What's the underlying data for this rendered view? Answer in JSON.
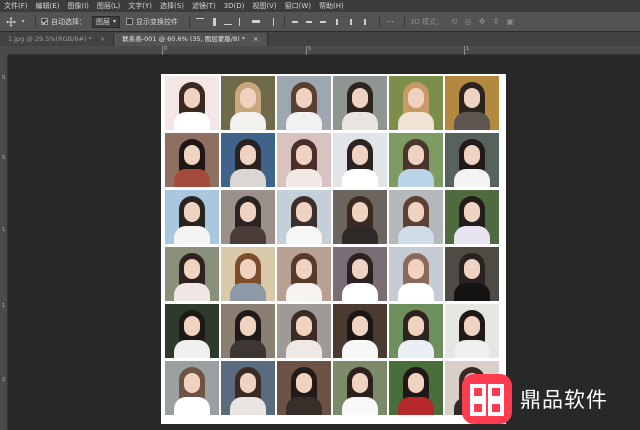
{
  "menu": [
    "文件(F)",
    "编辑(E)",
    "图像(I)",
    "图层(L)",
    "文字(Y)",
    "选择(S)",
    "滤镜(T)",
    "3D(D)",
    "视图(V)",
    "窗口(W)",
    "帮助(H)"
  ],
  "options": {
    "auto_select_label": "自动选择：",
    "auto_select_value": "图层",
    "show_transform_label": "显示变换控件",
    "mode_3d_label": "3D 模式："
  },
  "tabs": [
    {
      "label": "1.jpg @ 29.5%(RGB/8#) *",
      "close": "×"
    },
    {
      "label": "联系表-001 @ 60.6% (35, 图层蒙版/8) *",
      "close": "×"
    }
  ],
  "ruler": {
    "top": [
      "0",
      "5",
      "1"
    ],
    "left": [
      "0",
      "5",
      "1",
      "1",
      "2"
    ]
  },
  "photos": [
    {
      "bg": "#f2e7e4",
      "hair": "#3b2a22",
      "body": "#ffffff"
    },
    {
      "bg": "#6f6a4a",
      "hair": "#c9a77d",
      "body": "#f3f1ee"
    },
    {
      "bg": "#9ea7b0",
      "hair": "#5a4032",
      "body": "#f1f1f1"
    },
    {
      "bg": "#8f9692",
      "hair": "#2d231f",
      "body": "#e7e4e1"
    },
    {
      "bg": "#7b8f4b",
      "hair": "#c99a68",
      "body": "#f0e3d3"
    },
    {
      "bg": "#b2893e",
      "hair": "#2b241f",
      "body": "#5e5550"
    },
    {
      "bg": "#8d7062",
      "hair": "#1f1716",
      "body": "#a44b3b"
    },
    {
      "bg": "#3f6389",
      "hair": "#2a2220",
      "body": "#d9d6d4"
    },
    {
      "bg": "#d8c3c0",
      "hair": "#4b2f2a",
      "body": "#f2e9e6"
    },
    {
      "bg": "#e2e5e8",
      "hair": "#2c2422",
      "body": "#ffffff"
    },
    {
      "bg": "#7e9b63",
      "hair": "#4a352c",
      "body": "#bcd4ea"
    },
    {
      "bg": "#58625c",
      "hair": "#201a18",
      "body": "#f4f4f4"
    },
    {
      "bg": "#a9c8df",
      "hair": "#2b2320",
      "body": "#f5f5f5"
    },
    {
      "bg": "#9b8f89",
      "hair": "#2a2220",
      "body": "#4a3d38"
    },
    {
      "bg": "#c4cfd8",
      "hair": "#3a2f2a",
      "body": "#f6f6f6"
    },
    {
      "bg": "#6c6560",
      "hair": "#3a2a22",
      "body": "#2f2a28"
    },
    {
      "bg": "#b4b8bb",
      "hair": "#5b4133",
      "body": "#cfdbe6"
    },
    {
      "bg": "#4f6a3e",
      "hair": "#231c1a",
      "body": "#e8e4f2"
    },
    {
      "bg": "#8a8f79",
      "hair": "#2e2320",
      "body": "#efe7e5"
    },
    {
      "bg": "#d9c9a9",
      "hair": "#7a4e2b",
      "body": "#8c9aa8"
    },
    {
      "bg": "#b79f91",
      "hair": "#5a3a2d",
      "body": "#f6f3f0"
    },
    {
      "bg": "#7a6d76",
      "hair": "#2a2120",
      "body": "#ffffff"
    },
    {
      "bg": "#c4cbd2",
      "hair": "#8a6a5a",
      "body": "#ffffff"
    },
    {
      "bg": "#4d4b44",
      "hair": "#2a2220",
      "body": "#141212"
    },
    {
      "bg": "#2e3a2b",
      "hair": "#1e1816",
      "body": "#f0f0f0"
    },
    {
      "bg": "#8a7e72",
      "hair": "#1f1917",
      "body": "#3d3633"
    },
    {
      "bg": "#9e9a96",
      "hair": "#3b2b25",
      "body": "#efe8e4"
    },
    {
      "bg": "#4a3a2f",
      "hair": "#1c1614",
      "body": "#f7f7f7"
    },
    {
      "bg": "#6c8f5b",
      "hair": "#2e2420",
      "body": "#ebeef2"
    },
    {
      "bg": "#e6e6e3",
      "hair": "#1f1918",
      "body": "#efefef"
    },
    {
      "bg": "#9aa0a0",
      "hair": "#6e5444",
      "body": "#ffffff"
    },
    {
      "bg": "#5a6b80",
      "hair": "#3a2a24",
      "body": "#e9e5e2"
    },
    {
      "bg": "#6b5244",
      "hair": "#221a18",
      "body": "#3a2e2a"
    },
    {
      "bg": "#7d8a6a",
      "hair": "#2a201c",
      "body": "#f8f8f8"
    },
    {
      "bg": "#4a6d3c",
      "hair": "#1f1816",
      "body": "#b7282b"
    },
    {
      "bg": "#d8cfc8",
      "hair": "#3a2a22",
      "body": "#2d2b2a"
    }
  ],
  "watermark": {
    "text": "鼎品软件",
    "color": "#ff3b4f"
  }
}
